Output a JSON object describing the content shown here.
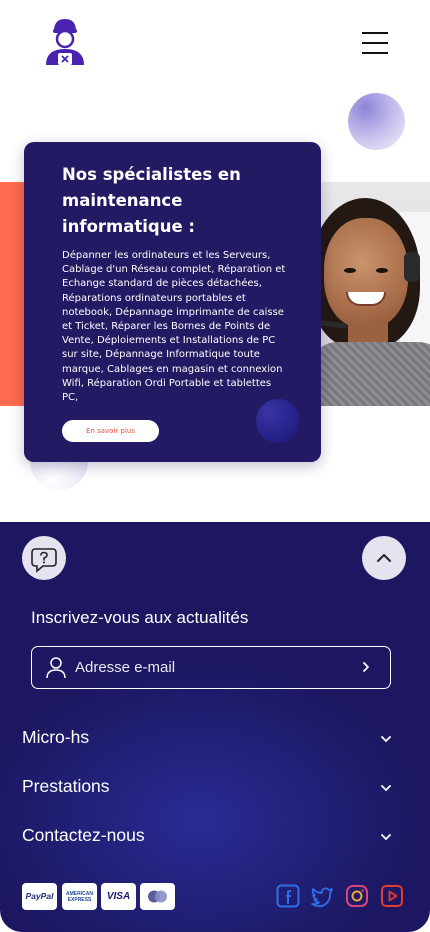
{
  "header": {
    "logo_icon": "technician-logo-icon",
    "menu_icon": "hamburger-menu-icon"
  },
  "hero": {
    "card_title": "Nos spécialistes en maintenance informatique :",
    "card_text": "Dépanner les ordinateurs et les Serveurs, Cablage d'un Réseau complet, Réparation et Echange standard de pièces détachées, Réparations ordinateurs portables et notebook, Dépannage imprimante de caisse et Ticket, Réparer les Bornes de Points de Vente, Déploiements et Installations de PC sur site, Dépannage Informatique toute marque, Cablages en magasin et connexion Wifi, Réparation Ordi Portable et tablettes PC,",
    "cta_label": "En savoir plus",
    "photo": "support-agent-photo",
    "colors": {
      "card": "#221a63",
      "accent": "#ff6b4e",
      "cta_text": "#e5533e"
    }
  },
  "footer": {
    "help_icon": "help-chat-icon",
    "back_to_top_icon": "chevron-up-icon",
    "newsletter": {
      "title": "Inscrivez-vous aux actualités",
      "email_placeholder": "Adresse e-mail"
    },
    "sections": [
      {
        "label": "Micro-hs"
      },
      {
        "label": "Prestations"
      },
      {
        "label": "Contactez-nous"
      }
    ],
    "payments": {
      "paypal": "PayPal",
      "amex": "AMERICAN EXPRESS",
      "visa": "VISA"
    },
    "social": [
      "facebook-icon",
      "twitter-icon",
      "instagram-icon",
      "youtube-icon"
    ],
    "colors": {
      "background": "#1c1760",
      "social_blue": "#2f6ee8",
      "youtube_red": "#e53935"
    }
  }
}
